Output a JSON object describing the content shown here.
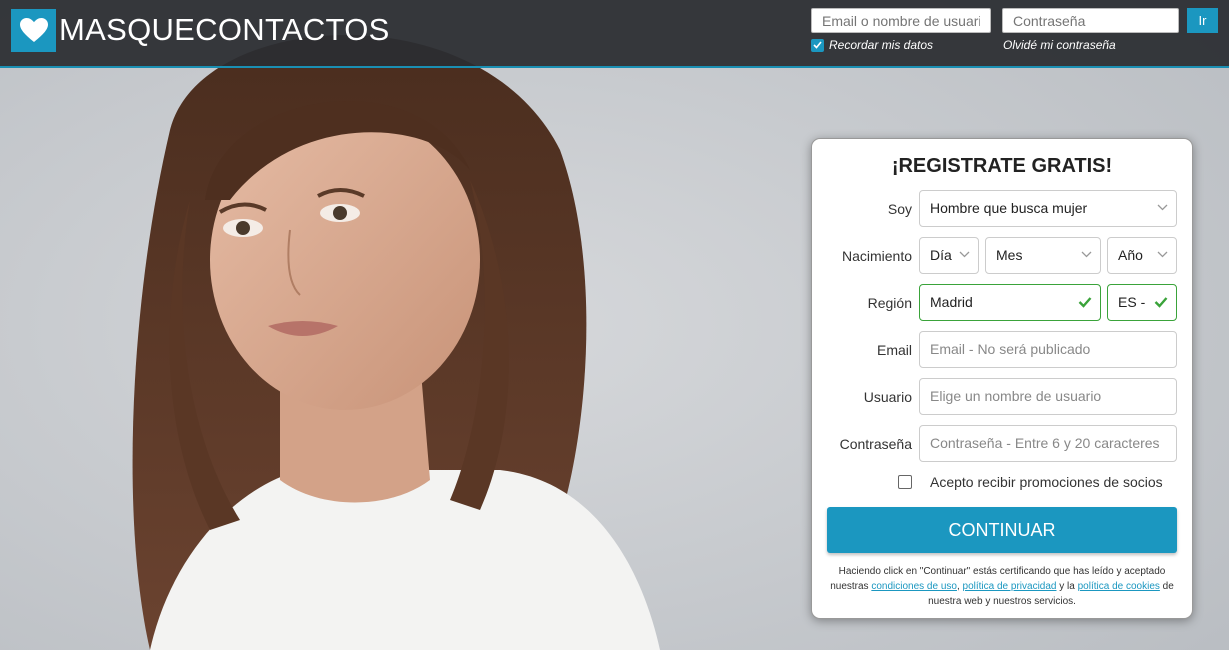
{
  "brand": {
    "name": "MASQUECONTACTOS",
    "accent": "#1b97c0"
  },
  "header": {
    "login_placeholder": "Email o nombre de usuario",
    "password_placeholder": "Contraseña",
    "go_label": "Ir",
    "remember_label": "Recordar mis datos",
    "remember_checked": true,
    "forgot_label": "Olvidé mi contraseña"
  },
  "form": {
    "title": "¡REGISTRATE GRATIS!",
    "soy_label": "Soy",
    "soy_value": "Hombre que busca mujer",
    "birth_label": "Nacimiento",
    "day_value": "Día",
    "month_value": "Mes",
    "year_value": "Año",
    "region_label": "Región",
    "region_value": "Madrid",
    "country_value": "ES -",
    "email_label": "Email",
    "email_placeholder": "Email - No será publicado",
    "user_label": "Usuario",
    "user_placeholder": "Elige un nombre de usuario",
    "password_label": "Contraseña",
    "password_placeholder": "Contraseña - Entre 6 y 20 caracteres",
    "promo_label": "Acepto recibir promociones de socios",
    "promo_checked": false,
    "submit_label": "CONTINUAR",
    "legal_prefix": "Haciendo click en \"Continuar\" estás certificando que has leído y aceptado nuestras",
    "legal_terms": "condiciones de uso",
    "legal_sep1": ",",
    "legal_privacy": "política de privacidad",
    "legal_and": "y la",
    "legal_cookies": "política de cookies",
    "legal_suffix": "de nuestra web y nuestros servicios."
  }
}
